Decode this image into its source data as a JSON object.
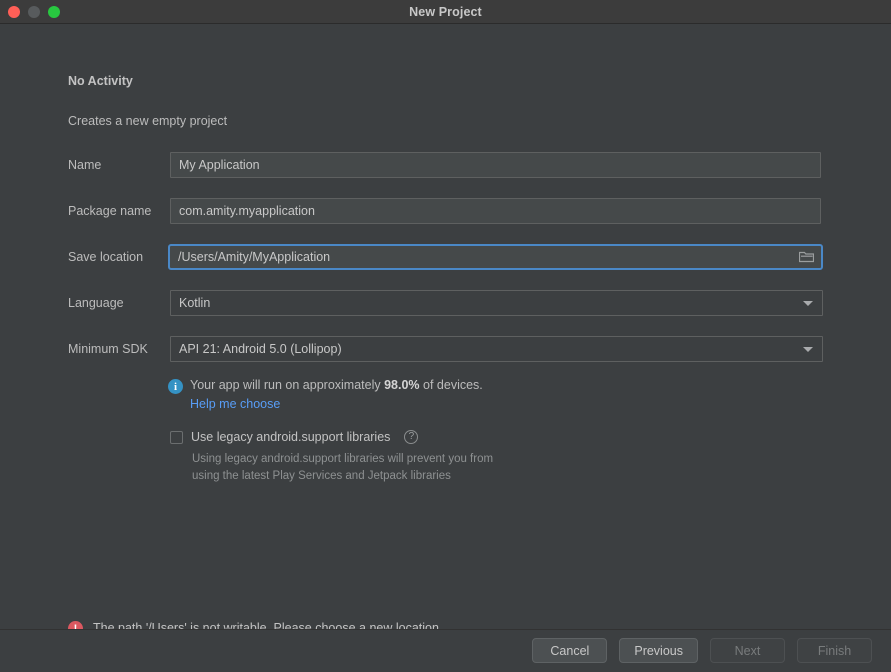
{
  "window": {
    "title": "New Project",
    "traffic_lights": [
      "close-red",
      "minimize-gray",
      "zoom-green"
    ]
  },
  "form": {
    "heading": "No Activity",
    "subheading": "Creates a new empty project",
    "fields": [
      {
        "label": "Name",
        "value": "My Application",
        "type": "text"
      },
      {
        "label": "Package name",
        "value": "com.amity.myapplication",
        "type": "text"
      },
      {
        "label": "Save location",
        "value": "/Users/Amity/MyApplication",
        "type": "text-browse",
        "focused": true,
        "icon": "folder-icon"
      },
      {
        "label": "Language",
        "value": "Kotlin",
        "type": "combo"
      },
      {
        "label": "Minimum SDK",
        "value": "API 21: Android 5.0 (Lollipop)",
        "type": "combo"
      }
    ]
  },
  "info": {
    "icon": "info-icon",
    "text_before": "Your app will run on approximately ",
    "percent": "98.0%",
    "text_after": " of devices.",
    "link": "Help me choose"
  },
  "legacy": {
    "checkbox_checked": false,
    "label": "Use legacy android.support libraries",
    "help_icon": "question-mark-icon",
    "description_line1": "Using legacy android.support libraries will prevent you from",
    "description_line2": "using the latest Play Services and Jetpack libraries"
  },
  "error": {
    "icon": "error-icon",
    "message": "The path '/Users' is not writable. Please choose a new location."
  },
  "footer": {
    "buttons": [
      {
        "label": "Cancel",
        "enabled": true
      },
      {
        "label": "Previous",
        "enabled": true
      },
      {
        "label": "Next",
        "enabled": false
      },
      {
        "label": "Finish",
        "enabled": false
      }
    ]
  },
  "colors": {
    "background": "#3c3f41",
    "titlebar": "#3c3c3c",
    "accent_focus": "#4a88c7",
    "link": "#589df6",
    "info": "#3592c4",
    "error": "#db5860"
  }
}
